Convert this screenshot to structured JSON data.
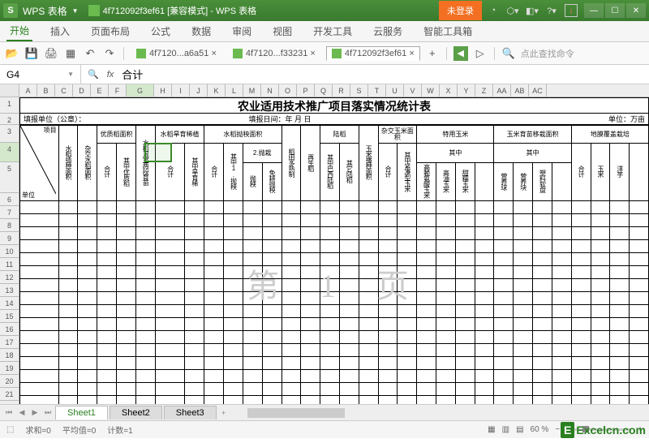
{
  "app": {
    "logo": "S",
    "name": "WPS 表格",
    "doc_title": "4f712092f3ef61 [兼容模式] - WPS 表格",
    "login": "未登录"
  },
  "menu": {
    "items": [
      "开始",
      "插入",
      "页面布局",
      "公式",
      "数据",
      "审阅",
      "视图",
      "开发工具",
      "云服务",
      "智能工具箱"
    ],
    "active": 0
  },
  "doctabs": [
    {
      "label": "4f7120...a6a51 ×"
    },
    {
      "label": "4f7120...f33231 ×"
    },
    {
      "label": "4f712092f3ef61 ×",
      "active": true
    }
  ],
  "search_placeholder": "点此查找命令",
  "formula": {
    "cell": "G4",
    "fx": "fx",
    "value": "合计"
  },
  "columns": [
    "A",
    "B",
    "C",
    "D",
    "E",
    "F",
    "G",
    "H",
    "I",
    "J",
    "K",
    "L",
    "M",
    "N",
    "O",
    "P",
    "Q",
    "R",
    "S",
    "T",
    "U",
    "V",
    "W",
    "X",
    "Y",
    "Z",
    "AA",
    "AB",
    "AC"
  ],
  "sel_col_idx": 6,
  "rows_total": 22,
  "table": {
    "title": "农业适用技术推广项目落实情况统计表",
    "info_left": "填报单位（公章）：",
    "info_mid": "填报日间：年 月 日",
    "info_right": "单位：万亩",
    "diag_top": "项目",
    "diag_bot": "单位",
    "groups": {
      "g1": "优质稻面积",
      "g2": "水稻旱育稀植",
      "g3": "水稻抛秧面积",
      "g4": "陆稻",
      "g5": "杂交玉米面积",
      "g6": "特用玉米",
      "g7": "玉米育苗移栽面积",
      "g8": "地膜覆盖栽培"
    },
    "cols": {
      "c1": "水稻插种面积",
      "c2": "杂交水稻面积",
      "c3": "合计",
      "c4": "其中优质稻",
      "c5": "水稻温室两段育苗",
      "c6": "合计",
      "c7": "其中旱育稀",
      "c8": "合计",
      "c9": "其中1.抛秧",
      "c10": "2.抛栽",
      "c10a": "抛秧",
      "c10b": "免耕抛秧",
      "c11": "稻田多熟制",
      "c12": "再生稻",
      "c13": "其中巴西陆稻",
      "c14": "其它陆稻",
      "c15": "玉米播种面积",
      "c16": "合计",
      "c17": "其中紧凑型玉米",
      "c18": "其中",
      "c19": "高赖氨酸玉米",
      "c20": "高油玉米",
      "c21": "甜糯玉米",
      "c22": "其中",
      "c23": "营养球",
      "c24": "营养块",
      "c25": "塑料软盘",
      "c26": "合计",
      "c27": "玉米",
      "c28": "洋芋"
    }
  },
  "watermark": "第 1 页",
  "sheets": {
    "tabs": [
      "Sheet1",
      "Sheet2",
      "Sheet3"
    ],
    "active": 0
  },
  "status": {
    "sum": "求和=0",
    "avg": "平均值=0",
    "count": "计数=1",
    "zoom": "60 %"
  },
  "brand": {
    "e": "E",
    "txt": "Excelcn.com"
  }
}
